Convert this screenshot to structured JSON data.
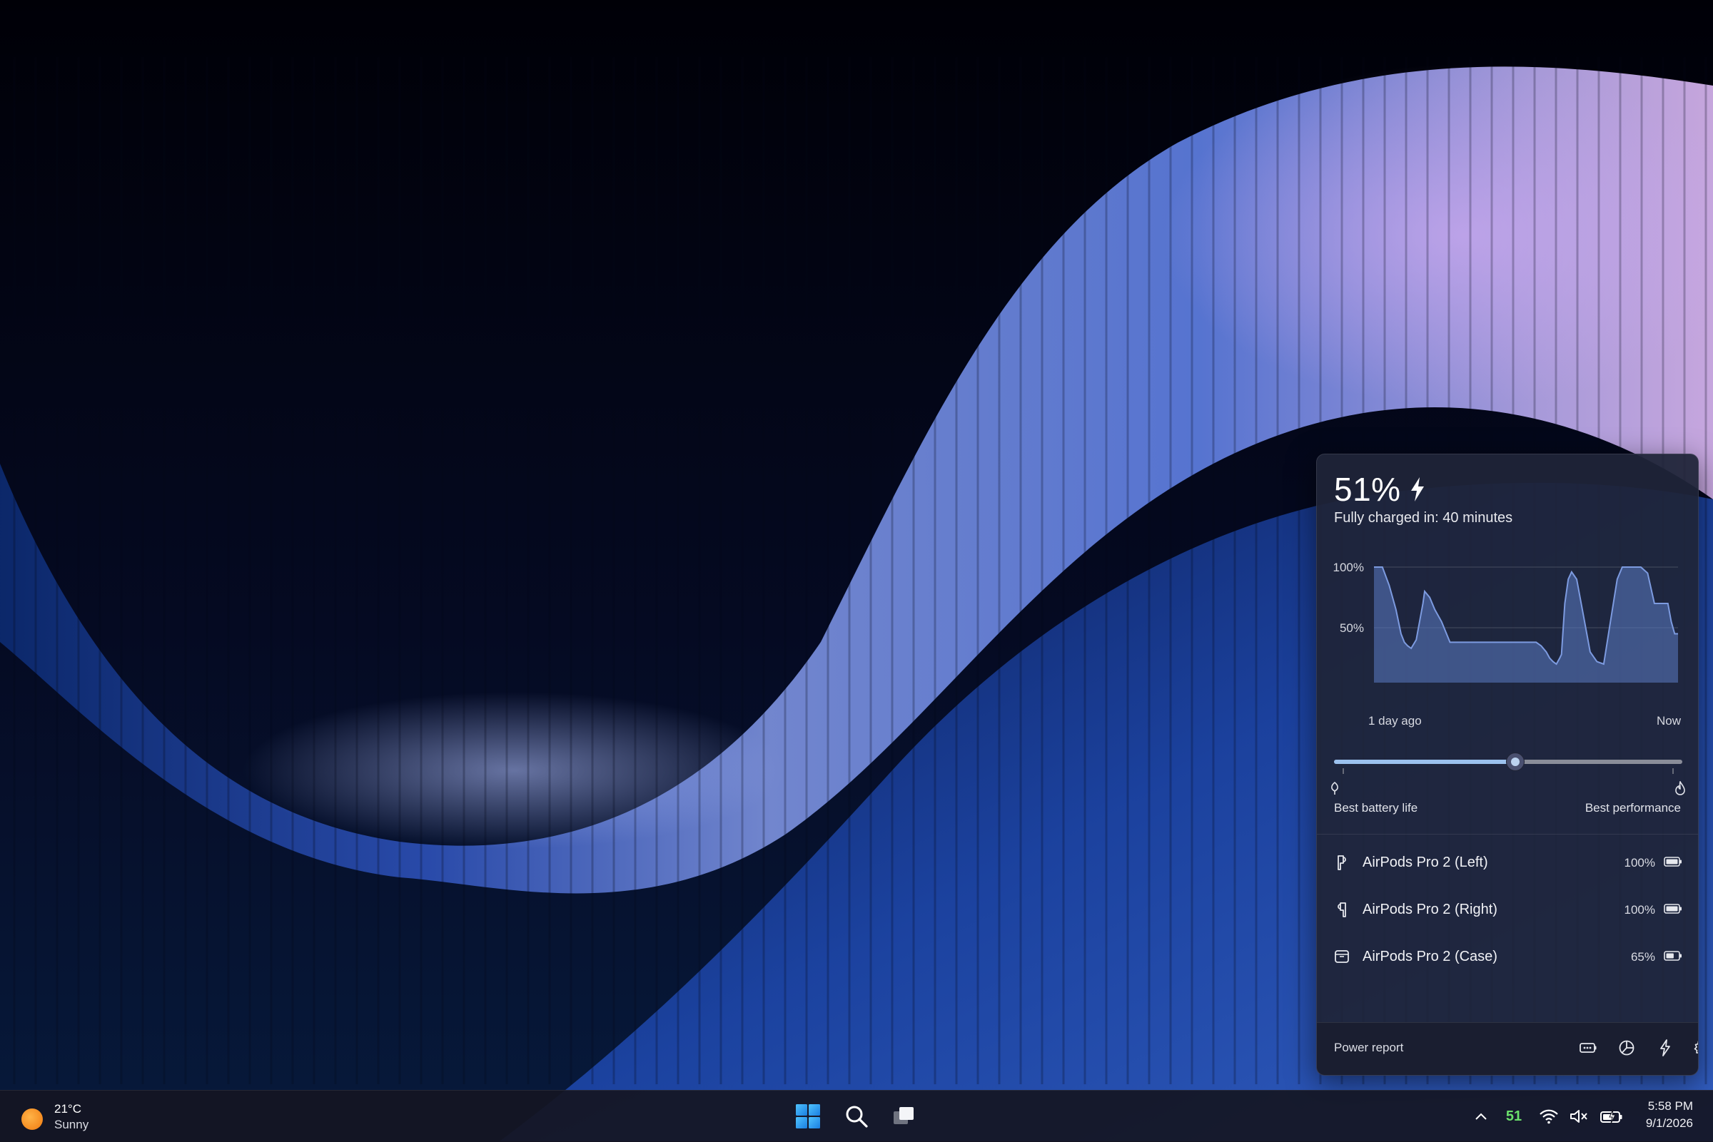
{
  "battery": {
    "percent_label": "51%",
    "percent_value": 51,
    "charging": true,
    "charge_time_text": "Fully charged in: 40 minutes"
  },
  "chart_data": {
    "type": "area",
    "y_ticks": [
      "100%",
      "50%"
    ],
    "ylim": [
      0,
      100
    ],
    "x_start_label": "1 day ago",
    "x_end_label": "Now",
    "x": [
      0,
      1,
      2,
      3,
      5,
      9,
      13,
      16,
      18,
      20,
      22,
      25,
      29,
      30,
      33,
      36,
      40,
      45,
      60,
      80,
      96,
      99,
      102,
      104,
      106,
      108,
      110,
      111,
      113,
      115,
      117,
      120,
      124,
      128,
      132,
      136,
      140,
      144,
      147,
      150,
      152,
      155,
      158,
      162,
      166,
      170,
      174,
      176,
      178,
      180
    ],
    "values": [
      100,
      100,
      100,
      100,
      100,
      85,
      65,
      45,
      38,
      35,
      33,
      40,
      70,
      80,
      75,
      65,
      55,
      38,
      38,
      38,
      38,
      35,
      30,
      25,
      22,
      20,
      25,
      28,
      70,
      90,
      96,
      90,
      60,
      30,
      22,
      20,
      55,
      90,
      100,
      100,
      100,
      100,
      100,
      95,
      70,
      70,
      70,
      55,
      45,
      45
    ],
    "color": "#5b7bc4",
    "grid": true
  },
  "power_mode": {
    "value_fraction": 0.52,
    "left_label": "Best battery life",
    "right_label": "Best performance"
  },
  "devices": [
    {
      "name": "AirPods Pro 2 (Left)",
      "percent": "100%",
      "level": 1.0,
      "icon": "earbud-left-icon"
    },
    {
      "name": "AirPods Pro 2 (Right)",
      "percent": "100%",
      "level": 1.0,
      "icon": "earbud-right-icon"
    },
    {
      "name": "AirPods Pro 2 (Case)",
      "percent": "65%",
      "level": 0.65,
      "icon": "case-icon"
    }
  ],
  "footer": {
    "power_report_label": "Power report",
    "icons": [
      "battery-saver-icon",
      "usage-pie-icon",
      "power-plan-icon",
      "settings-icon"
    ]
  },
  "taskbar": {
    "weather_temp": "21°C",
    "weather_condition": "Sunny",
    "tray_number": "51",
    "time": "5:58 PM",
    "date": "9/1/2026"
  }
}
